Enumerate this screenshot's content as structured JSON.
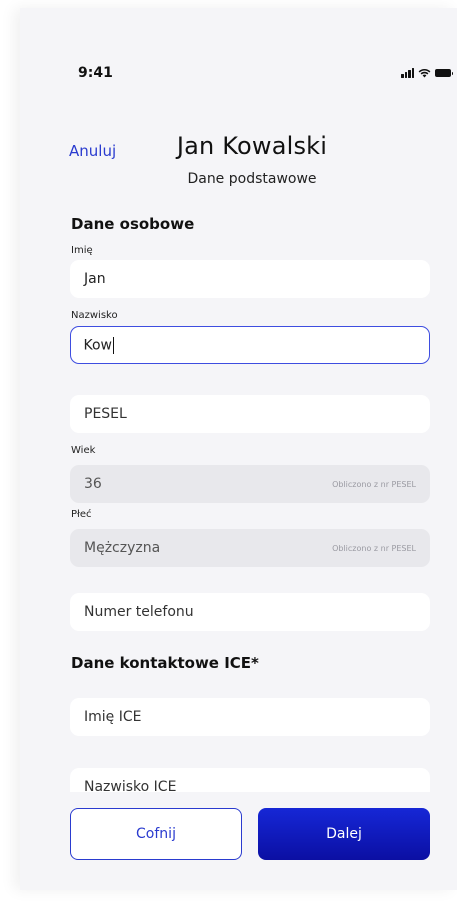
{
  "status_bar": {
    "time": "9:41",
    "icons": [
      "signal-icon",
      "wifi-icon",
      "battery-icon"
    ]
  },
  "header": {
    "cancel_label": "Anuluj",
    "title": "Jan Kowalski",
    "subtitle": "Dane podstawowe"
  },
  "personal": {
    "section_title": "Dane osobowe",
    "first_name": {
      "label": "Imię",
      "value": "Jan"
    },
    "last_name": {
      "label": "Nazwisko",
      "value": "Kow"
    },
    "pesel": {
      "placeholder": "PESEL"
    },
    "age": {
      "label": "Wiek",
      "value": "36",
      "hint": "Obliczono z nr PESEL"
    },
    "gender": {
      "label": "Płeć",
      "value": "Mężczyzna",
      "hint": "Obliczono z nr PESEL"
    },
    "phone": {
      "placeholder": "Numer telefonu"
    }
  },
  "ice": {
    "section_title": "Dane kontaktowe ICE*",
    "first_name": {
      "placeholder": "Imię ICE"
    },
    "last_name": {
      "placeholder": "Nazwisko ICE"
    }
  },
  "footer": {
    "back_label": "Cofnij",
    "next_label": "Dalej"
  },
  "colors": {
    "accent": "#2a3bcf",
    "primary_button": "#1221c9",
    "background": "#f5f5f8",
    "disabled_field": "#e8e8ec"
  }
}
